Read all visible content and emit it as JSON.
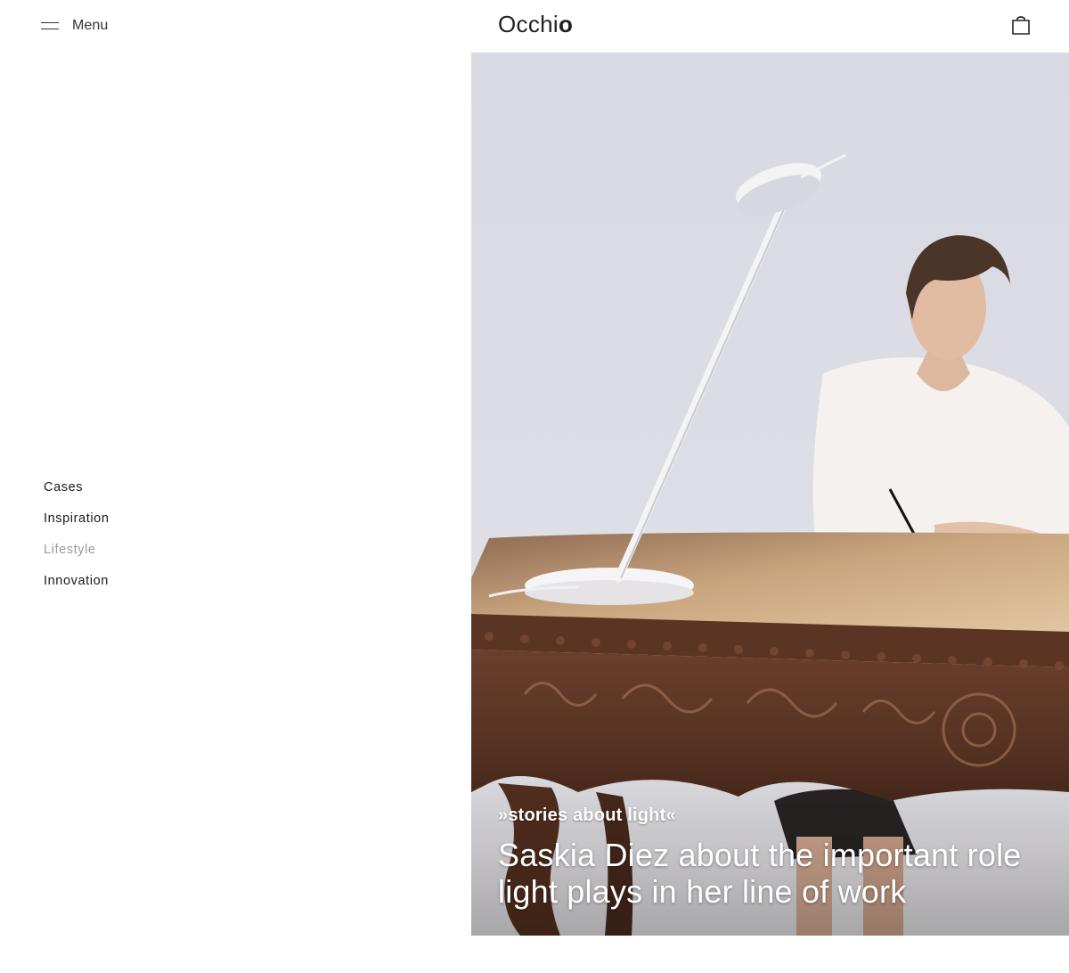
{
  "header": {
    "menu_label": "Menu",
    "logo_text": "Occhi",
    "logo_bold": "o"
  },
  "side_nav": {
    "items": [
      {
        "label": "Cases",
        "active": false
      },
      {
        "label": "Inspiration",
        "active": false
      },
      {
        "label": "Lifestyle",
        "active": true
      },
      {
        "label": "Innovation",
        "active": false
      }
    ]
  },
  "hero": {
    "kicker": "»stories about light«",
    "title": "Saskia Diez about the important role light plays in her line of work"
  },
  "icons": {
    "menu": "hamburger-icon",
    "cart": "shopping-bag-icon"
  },
  "colors": {
    "text": "#1a1a1a",
    "muted": "#9a9a9a",
    "hero_background": "#dcdce4"
  }
}
